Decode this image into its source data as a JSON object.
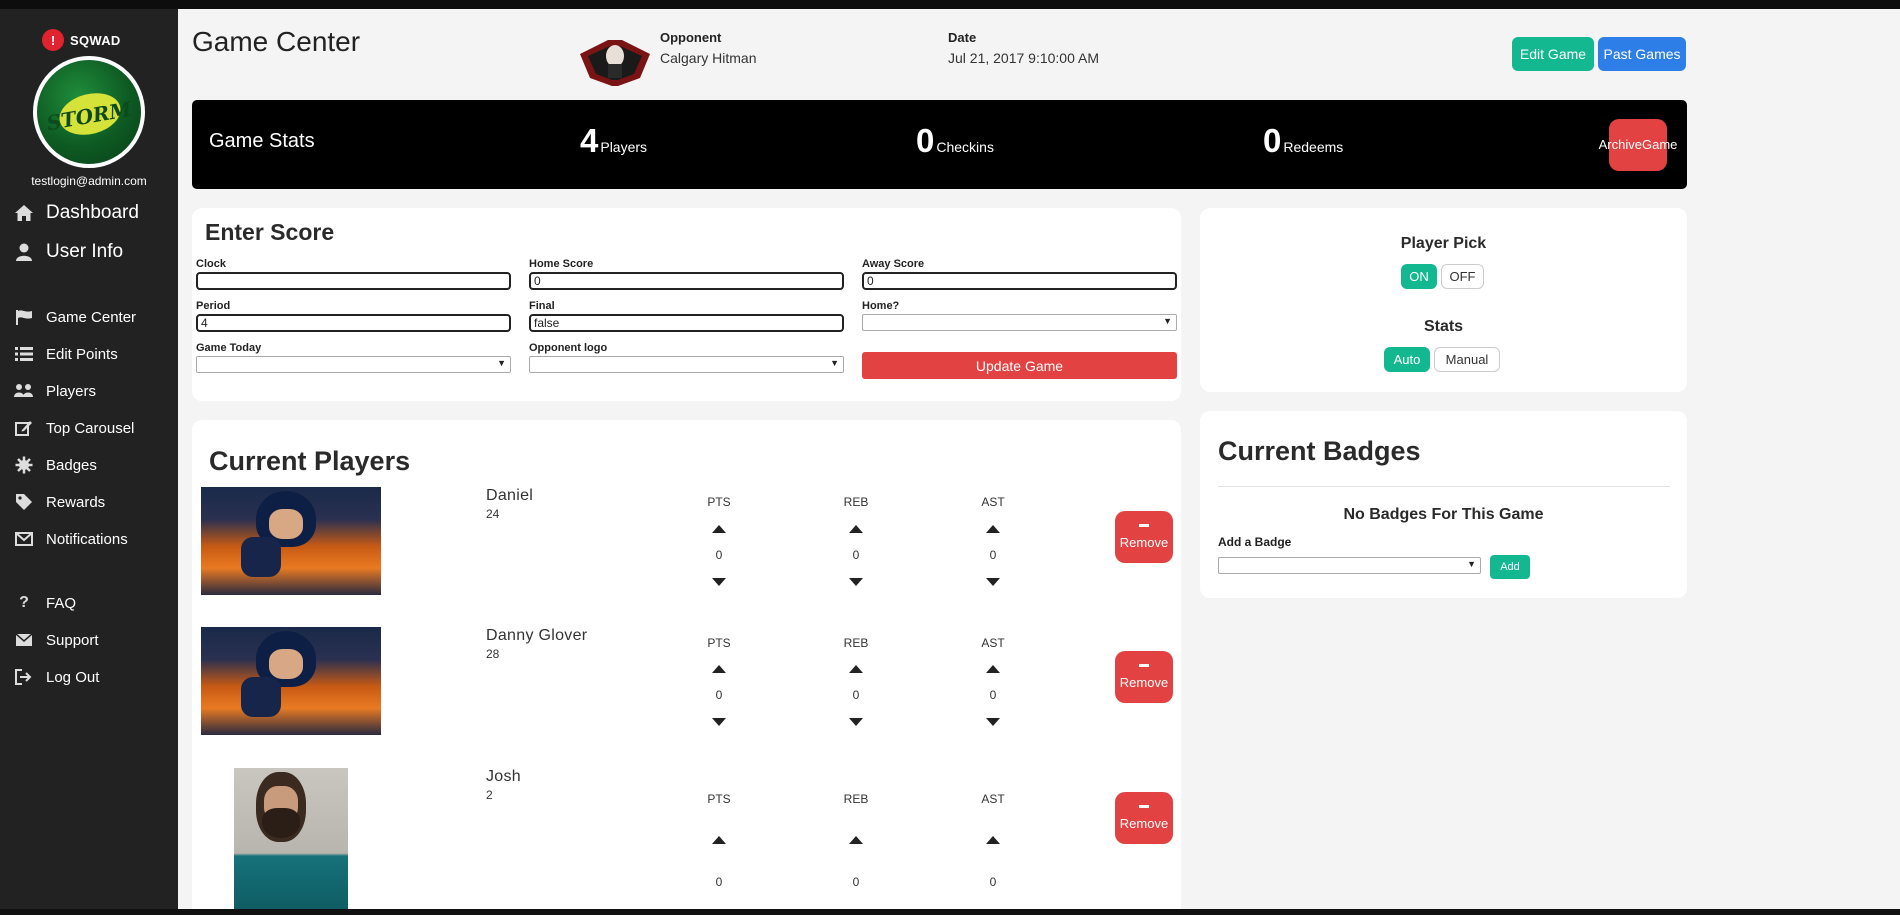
{
  "sidebar": {
    "brand": "SQWAD",
    "brand_mark": "!",
    "team_logo_text": "STORM",
    "email": "testlogin@admin.com",
    "primary_items": [
      {
        "label": "Dashboard",
        "icon": "home-icon"
      },
      {
        "label": "User Info",
        "icon": "user-icon"
      }
    ],
    "items": [
      {
        "label": "Game Center",
        "icon": "flag-icon"
      },
      {
        "label": "Edit Points",
        "icon": "list-icon"
      },
      {
        "label": "Players",
        "icon": "users-icon"
      },
      {
        "label": "Top Carousel",
        "icon": "edit-icon"
      },
      {
        "label": "Badges",
        "icon": "badge-icon"
      },
      {
        "label": "Rewards",
        "icon": "tag-icon"
      },
      {
        "label": "Notifications",
        "icon": "envelope-icon"
      }
    ],
    "footer_items": [
      {
        "label": "FAQ",
        "icon": "question-icon"
      },
      {
        "label": "Support",
        "icon": "envelope-icon"
      },
      {
        "label": "Log Out",
        "icon": "logout-icon"
      }
    ]
  },
  "header": {
    "title": "Game Center",
    "opponent_label": "Opponent",
    "opponent_value": "Calgary Hitman",
    "date_label": "Date",
    "date_value": "Jul 21, 2017 9:10:00 AM",
    "edit_game": "Edit Game",
    "past_games": "Past Games"
  },
  "stats_bar": {
    "title": "Game Stats",
    "players_count": "4",
    "players_label": "Players",
    "checkins_count": "0",
    "checkins_label": "Checkins",
    "redeems_count": "0",
    "redeems_label": "Redeems",
    "archive_line1": "Archive",
    "archive_line2": "Game"
  },
  "enter_score": {
    "title": "Enter Score",
    "clock_label": "Clock",
    "clock_value": "",
    "home_score_label": "Home Score",
    "home_score_value": "0",
    "away_score_label": "Away Score",
    "away_score_value": "0",
    "period_label": "Period",
    "period_value": "4",
    "final_label": "Final",
    "final_value": "false",
    "home_label": "Home?",
    "game_today_label": "Game Today",
    "opponent_logo_label": "Opponent logo",
    "update_button": "Update Game"
  },
  "current_players": {
    "title": "Current Players",
    "stat_headers": [
      "PTS",
      "REB",
      "AST"
    ],
    "remove_label": "Remove",
    "players": [
      {
        "name": "Daniel",
        "number": "24",
        "pts": "0",
        "reb": "0",
        "ast": "0"
      },
      {
        "name": "Danny Glover",
        "number": "28",
        "pts": "0",
        "reb": "0",
        "ast": "0"
      },
      {
        "name": "Josh",
        "number": "2",
        "pts": "0",
        "reb": "0",
        "ast": "0"
      }
    ]
  },
  "settings": {
    "player_pick_title": "Player Pick",
    "on_label": "ON",
    "off_label": "OFF",
    "stats_title": "Stats",
    "auto_label": "Auto",
    "manual_label": "Manual"
  },
  "badges": {
    "title": "Current Badges",
    "empty_text": "No Badges For This Game",
    "add_label": "Add a Badge",
    "add_button": "Add"
  },
  "colors": {
    "accent_teal": "#14b890",
    "accent_blue": "#2d7ee6",
    "danger_red": "#e34242",
    "sidebar_bg": "#222222"
  }
}
